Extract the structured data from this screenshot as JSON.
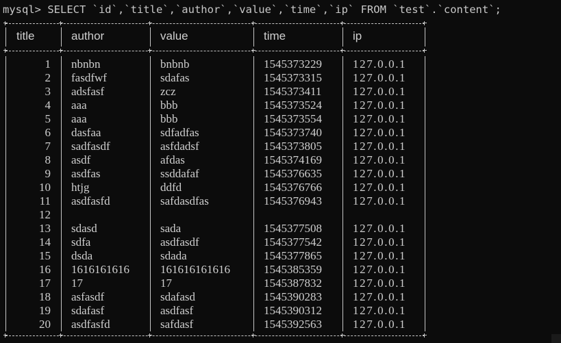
{
  "command": "mysql> SELECT `id`,`title`,`author`,`value`,`time`,`ip` FROM `test`.`content`;",
  "headers": [
    "title",
    "author",
    "value",
    "time",
    "ip"
  ],
  "rows": [
    {
      "id": "1",
      "author": "nbnbn",
      "value": "bnbnb",
      "time": "1545373229",
      "ip": "127.0.0.1"
    },
    {
      "id": "2",
      "author": "fasdfwf",
      "value": "sdafas",
      "time": "1545373315",
      "ip": "127.0.0.1"
    },
    {
      "id": "3",
      "author": "adsfasf",
      "value": "zcz",
      "time": "1545373411",
      "ip": "127.0.0.1"
    },
    {
      "id": "4",
      "author": "aaa",
      "value": "bbb",
      "time": "1545373524",
      "ip": "127.0.0.1"
    },
    {
      "id": "5",
      "author": "aaa",
      "value": "bbb",
      "time": "1545373554",
      "ip": "127.0.0.1"
    },
    {
      "id": "6",
      "author": "dasfaa",
      "value": "sdfadfas",
      "time": "1545373740",
      "ip": "127.0.0.1"
    },
    {
      "id": "7",
      "author": "sadfasdf",
      "value": "asfdadsf",
      "time": "1545373805",
      "ip": "127.0.0.1"
    },
    {
      "id": "8",
      "author": "asdf",
      "value": "afdas",
      "time": "1545374169",
      "ip": "127.0.0.1"
    },
    {
      "id": "9",
      "author": "asdfas",
      "value": "ssddafaf",
      "time": "1545376635",
      "ip": "127.0.0.1"
    },
    {
      "id": "10",
      "author": "htjg",
      "value": "ddfd",
      "time": "1545376766",
      "ip": "127.0.0.1"
    },
    {
      "id": "11",
      "author": "asdfasfd",
      "value": "safdasdfas",
      "time": "1545376943",
      "ip": "127.0.0.1"
    },
    {
      "id": "12",
      "author": "",
      "value": "",
      "time": "",
      "ip": ""
    },
    {
      "id": "13",
      "author": "sdasd",
      "value": "sada",
      "time": "1545377508",
      "ip": "127.0.0.1"
    },
    {
      "id": "14",
      "author": "sdfa",
      "value": "asdfasdf",
      "time": "1545377542",
      "ip": "127.0.0.1"
    },
    {
      "id": "15",
      "author": "dsda",
      "value": "sdada",
      "time": "1545377865",
      "ip": "127.0.0.1"
    },
    {
      "id": "16",
      "author": "1616161616",
      "value": "161616161616",
      "time": "1545385359",
      "ip": "127.0.0.1"
    },
    {
      "id": "17",
      "author": "17",
      "value": "17",
      "time": "1545387832",
      "ip": "127.0.0.1"
    },
    {
      "id": "18",
      "author": "asfasdf",
      "value": "sdafasd",
      "time": "1545390283",
      "ip": "127.0.0.1"
    },
    {
      "id": "19",
      "author": "sdafasf",
      "value": "asdfasf",
      "time": "1545390312",
      "ip": "127.0.0.1"
    },
    {
      "id": "20",
      "author": "asdfasfd",
      "value": "safdasf",
      "time": "1545392563",
      "ip": "127.0.0.1"
    }
  ]
}
